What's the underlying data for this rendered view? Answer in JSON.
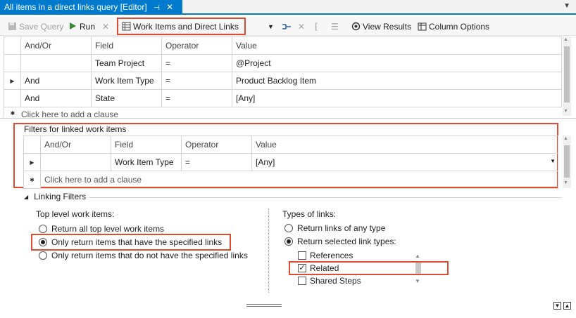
{
  "tab": {
    "title": "All items in a direct links query [Editor]",
    "pin_icon": "pin-icon",
    "close_icon": "close-icon"
  },
  "toolbar": {
    "save_label": "Save Query",
    "run_label": "Run",
    "query_type_label": "Work Items and Direct Links",
    "view_results_label": "View Results",
    "column_options_label": "Column Options"
  },
  "main_grid": {
    "headers": [
      "And/Or",
      "Field",
      "Operator",
      "Value"
    ],
    "rows": [
      {
        "andor": "",
        "field": "Team Project",
        "operator": "=",
        "value": "@Project"
      },
      {
        "andor": "And",
        "field": "Work Item Type",
        "operator": "=",
        "value": "Product Backlog Item"
      },
      {
        "andor": "And",
        "field": "State",
        "operator": "=",
        "value": "[Any]"
      }
    ],
    "add_clause": "Click here to add a clause"
  },
  "linked_grid": {
    "title": "Filters for linked work items",
    "headers": [
      "And/Or",
      "Field",
      "Operator",
      "Value"
    ],
    "rows": [
      {
        "andor": "",
        "field": "Work Item Type",
        "operator": "=",
        "value": "[Any]"
      }
    ],
    "add_clause": "Click here to add a clause"
  },
  "linking_filters": {
    "header": "Linking Filters",
    "top_level_label": "Top level work items:",
    "top_level_options": [
      {
        "label": "Return all top level work items",
        "selected": false
      },
      {
        "label": "Only return items that have the specified links",
        "selected": true
      },
      {
        "label": "Only return items that do not have the specified links",
        "selected": false
      }
    ],
    "types_label": "Types of links:",
    "types_options": [
      {
        "label": "Return links of any type",
        "selected": false
      },
      {
        "label": "Return selected link types:",
        "selected": true
      }
    ],
    "link_types": [
      {
        "label": "References",
        "checked": false
      },
      {
        "label": "Related",
        "checked": true
      },
      {
        "label": "Shared Steps",
        "checked": false
      }
    ]
  },
  "colors": {
    "accent": "#007acc",
    "highlight_box": "#e04c32"
  }
}
